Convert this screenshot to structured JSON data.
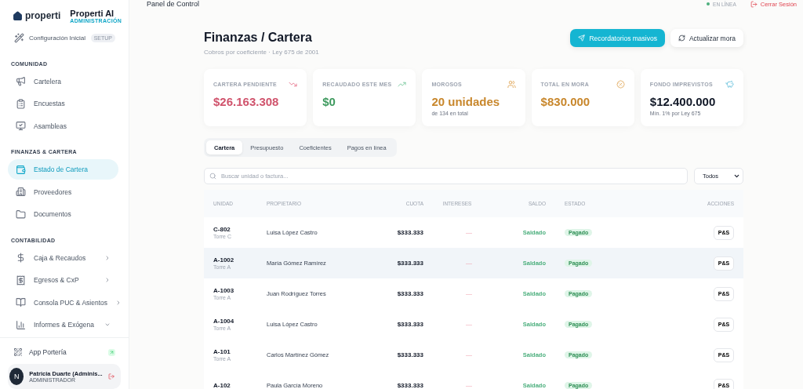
{
  "brand": {
    "logo_text": "properti",
    "title": "Properti AI",
    "subtitle": "ADMINISTRACIÓN"
  },
  "sidebar": {
    "top_items": [
      {
        "label": "Configuración Inicial",
        "badge": "SETUP",
        "selected": false
      }
    ],
    "sections": [
      {
        "title": "COMUNIDAD",
        "items": [
          {
            "label": "Cartelera",
            "kind": "link",
            "selected": false
          },
          {
            "label": "Encuestas",
            "kind": "link",
            "selected": false
          },
          {
            "label": "Asambleas",
            "kind": "link",
            "selected": false
          }
        ]
      },
      {
        "title": "FINANZAS & CARTERA",
        "items": [
          {
            "label": "Estado de Cartera",
            "kind": "link",
            "selected": true
          },
          {
            "label": "Proveedores",
            "kind": "link",
            "selected": false
          },
          {
            "label": "Documentos",
            "kind": "link",
            "selected": false
          }
        ]
      },
      {
        "title": "CONTABILIDAD",
        "items": [
          {
            "label": "Caja & Recaudos",
            "kind": "group",
            "expanded": false,
            "selected": false
          },
          {
            "label": "Egresos & CxP",
            "kind": "group",
            "expanded": false,
            "selected": false
          },
          {
            "label": "Consola PUC & Asientos",
            "kind": "group",
            "expanded": false,
            "selected": false
          },
          {
            "label": "Informes & Exógena",
            "kind": "group",
            "expanded": true,
            "selected": false
          }
        ]
      }
    ],
    "app_link": {
      "label": "App Portería"
    },
    "user": {
      "initial": "N",
      "name": "Patricia Duarte (Adminis...",
      "role": "ADMINISTRADOR"
    }
  },
  "topbar": {
    "title": "Panel de Control",
    "status": "EN LÍNEA",
    "online": true,
    "logout": "Cerrar Sesión"
  },
  "page": {
    "title": "Finanzas / Cartera",
    "subtitle": "Cobros por coeficiente · Ley 675 de 2001",
    "buttons": [
      {
        "label": "Recordatorios masivos",
        "kind": "primary"
      },
      {
        "label": "Actualizar mora",
        "kind": "secondary"
      }
    ]
  },
  "stats": [
    {
      "label": "CARTERA PENDIENTE",
      "value": "$26.163.308",
      "color": "#d0536c"
    },
    {
      "label": "RECAUDADO ESTE MES",
      "value": "$0",
      "color": "#3f9a5f"
    },
    {
      "label": "MOROSOS",
      "value": "20 unidades",
      "sub": "de 134 en total",
      "color": "#c8872c"
    },
    {
      "label": "TOTAL EN MORA",
      "value": "$830.000",
      "color": "#c8872c"
    },
    {
      "label": "FONDO IMPREVISTOS",
      "value": "$12.400.000",
      "sub": "Mín. 1% por Ley 675",
      "color": "#111827"
    }
  ],
  "tabs": [
    {
      "label": "Cartera",
      "selected": true
    },
    {
      "label": "Presupuesto",
      "selected": false
    },
    {
      "label": "Coeficientes",
      "selected": false
    },
    {
      "label": "Pagos en línea",
      "selected": false
    }
  ],
  "search": {
    "placeholder": "Buscar unidad o factura..."
  },
  "filter": {
    "value": "Todos"
  },
  "table": {
    "columns": [
      "UNIDAD",
      "PROPIETARIO",
      "CUOTA",
      "INTERESES",
      "SALDO",
      "ESTADO",
      "ACCIONES"
    ],
    "rows": [
      {
        "unit": "C-802",
        "tower": "Torre C",
        "owner": "Luisa López Castro",
        "fee": "$333.333",
        "interest": "—",
        "balance": "Saldado",
        "status": "Pagado",
        "action": "P&S",
        "selected": false
      },
      {
        "unit": "A-1002",
        "tower": "Torre A",
        "owner": "María Gómez Ramírez",
        "fee": "$333.333",
        "interest": "—",
        "balance": "Saldado",
        "status": "Pagado",
        "action": "P&S",
        "selected": true
      },
      {
        "unit": "A-1003",
        "tower": "Torre A",
        "owner": "Juan Rodríguez Torres",
        "fee": "$333.333",
        "interest": "—",
        "balance": "Saldado",
        "status": "Pagado",
        "action": "P&S",
        "selected": false
      },
      {
        "unit": "A-1004",
        "tower": "Torre A",
        "owner": "Luisa López Castro",
        "fee": "$333.333",
        "interest": "—",
        "balance": "Saldado",
        "status": "Pagado",
        "action": "P&S",
        "selected": false
      },
      {
        "unit": "A-101",
        "tower": "Torre A",
        "owner": "Carlos Martínez Gómez",
        "fee": "$333.333",
        "interest": "—",
        "balance": "Saldado",
        "status": "Pagado",
        "action": "P&S",
        "selected": false
      },
      {
        "unit": "A-102",
        "owner": "Paula García Moreno",
        "fee": "$333.333",
        "interest": "—",
        "balance": "Saldado",
        "status": "Pagado",
        "action": "P&S",
        "selected": false
      }
    ]
  }
}
